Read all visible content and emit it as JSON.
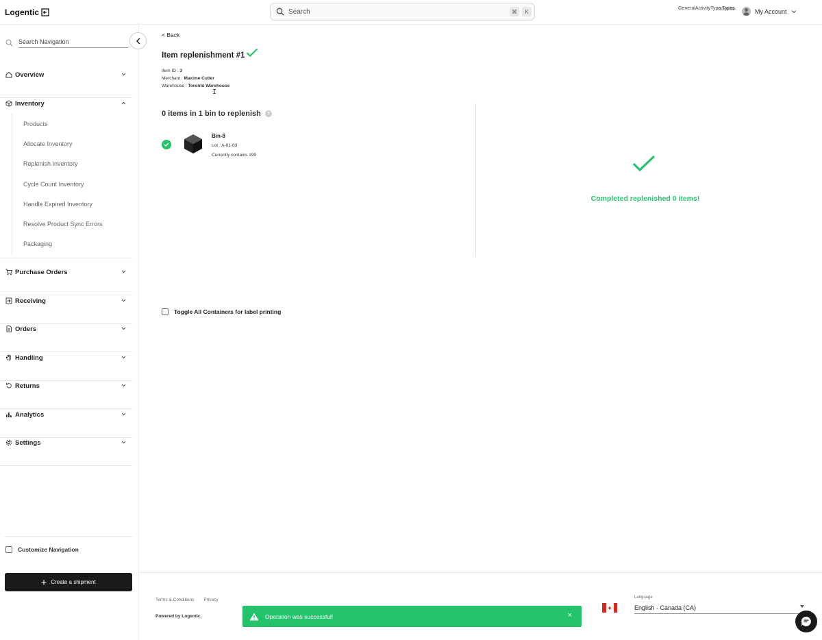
{
  "app": {
    "logo_text": "Logentic"
  },
  "header": {
    "search_placeholder": "Search",
    "shortcut_cmd": "⌘",
    "shortcut_key": "K",
    "activity_label": "GeneralActivityType.Types.",
    "timer": "00:00:08",
    "account_label": "My Account"
  },
  "sidebar": {
    "search_placeholder": "Search Navigation",
    "sections": [
      {
        "label": "Overview"
      },
      {
        "label": "Inventory"
      },
      {
        "label": "Purchase Orders"
      },
      {
        "label": "Receiving"
      },
      {
        "label": "Orders"
      },
      {
        "label": "Handling"
      },
      {
        "label": "Returns"
      },
      {
        "label": "Analytics"
      },
      {
        "label": "Settings"
      }
    ],
    "inventory_items": [
      "Products",
      "Allocate Inventory",
      "Replenish Inventory",
      "Cycle Count Inventory",
      "Handle Expired Inventory",
      "Resolve Product Sync Errors",
      "Packaging"
    ],
    "customize_label": "Customize Navigation",
    "create_shipment_label": "Create a shipment"
  },
  "main": {
    "back_label": "< Back",
    "title": "Item replenishment #1",
    "item_id_label": "Item ID : ",
    "item_id": "3",
    "merchant_label": "Merchant : ",
    "merchant": "Maxime Cutler",
    "warehouse_label": "Warehouse : ",
    "warehouse": "Toronto Warehouse",
    "subtitle": "0 items in 1 bin to replenish",
    "help": "?",
    "bin": {
      "name": "Bin-8",
      "lot": "Lot : A-01-03",
      "contains": "Currently contains 199"
    },
    "completed_text": "Completed replenished 0 items!",
    "toggle_all_label": "Toggle All Containers for label printing"
  },
  "footer": {
    "terms": "Terms & Conditions",
    "privacy": "Privacy",
    "powered_by": "Powered by Logentic.",
    "language_label": "Language",
    "language_value": "English - Canada (CA)"
  },
  "toast": {
    "message": "Operation was successful!",
    "close": "×",
    "color": "#25c26c"
  }
}
